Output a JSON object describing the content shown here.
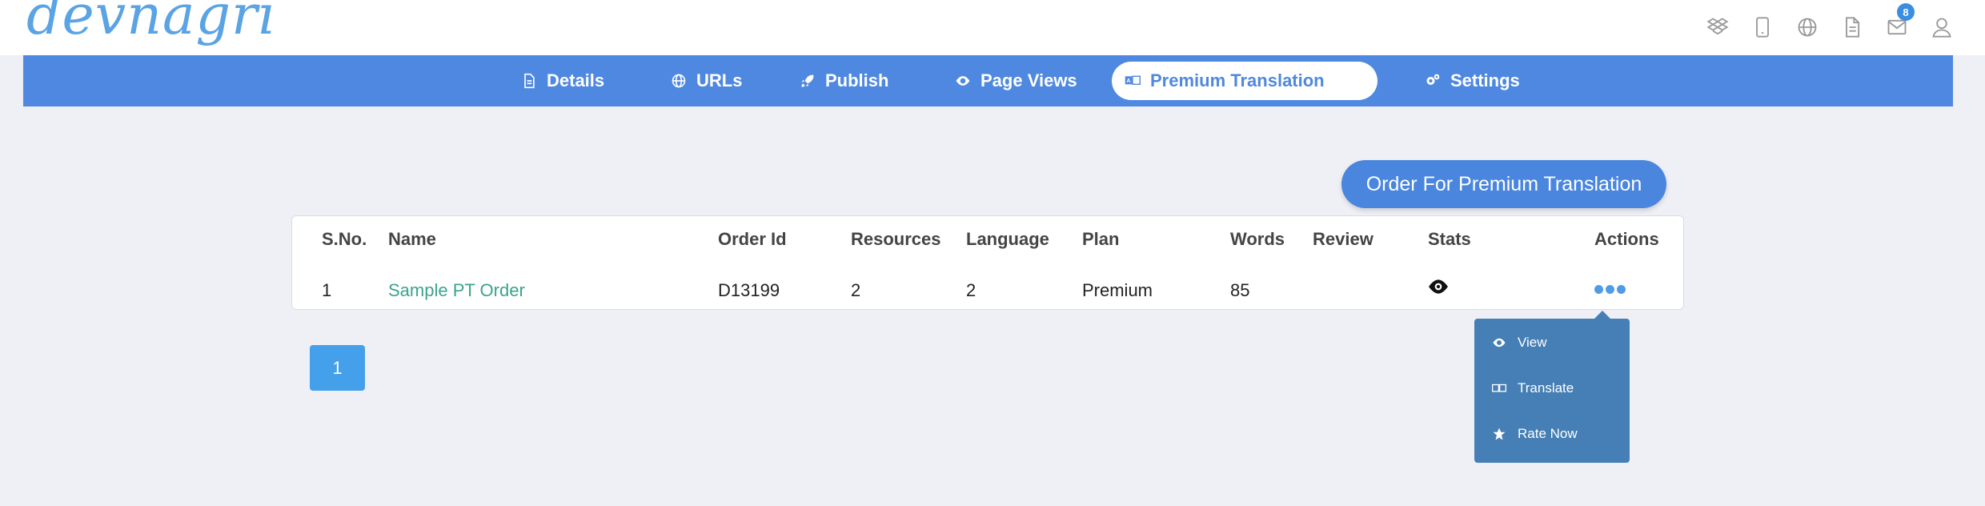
{
  "header": {
    "logo_text": "devnagri",
    "icons": [
      "dropbox-icon",
      "mobile-icon",
      "globe-icon",
      "document-icon",
      "mail-icon",
      "user-icon"
    ],
    "mail_badge": "8"
  },
  "nav": {
    "tabs": [
      {
        "label": "Details",
        "icon": "document-icon"
      },
      {
        "label": "URLs",
        "icon": "globe-icon"
      },
      {
        "label": "Publish",
        "icon": "rocket-icon"
      },
      {
        "label": "Page Views",
        "icon": "eye-icon"
      },
      {
        "label": "Premium Translation",
        "icon": "translate-icon",
        "active": true
      },
      {
        "label": "Settings",
        "icon": "gears-icon"
      }
    ]
  },
  "order_button": "Order For Premium Translation",
  "table": {
    "columns": [
      "S.No.",
      "Name",
      "Order Id",
      "Resources",
      "Language",
      "Plan",
      "Words",
      "Review",
      "Stats",
      "Actions"
    ],
    "rows": [
      {
        "sno": "1",
        "name": "Sample PT Order",
        "order_id": "D13199",
        "resources": "2",
        "language": "2",
        "plan": "Premium",
        "words": "85",
        "review": ""
      }
    ]
  },
  "actions_menu": {
    "items": [
      {
        "label": "View",
        "icon": "eye-icon"
      },
      {
        "label": "Translate",
        "icon": "translate-icon"
      },
      {
        "label": "Rate Now",
        "icon": "star-icon"
      }
    ]
  },
  "pagination": {
    "current_page": "1"
  },
  "colors": {
    "nav_bg": "#4f88e0",
    "accent": "#4a86de",
    "link": "#3aa38e",
    "dropdown_bg": "#467fb5"
  }
}
